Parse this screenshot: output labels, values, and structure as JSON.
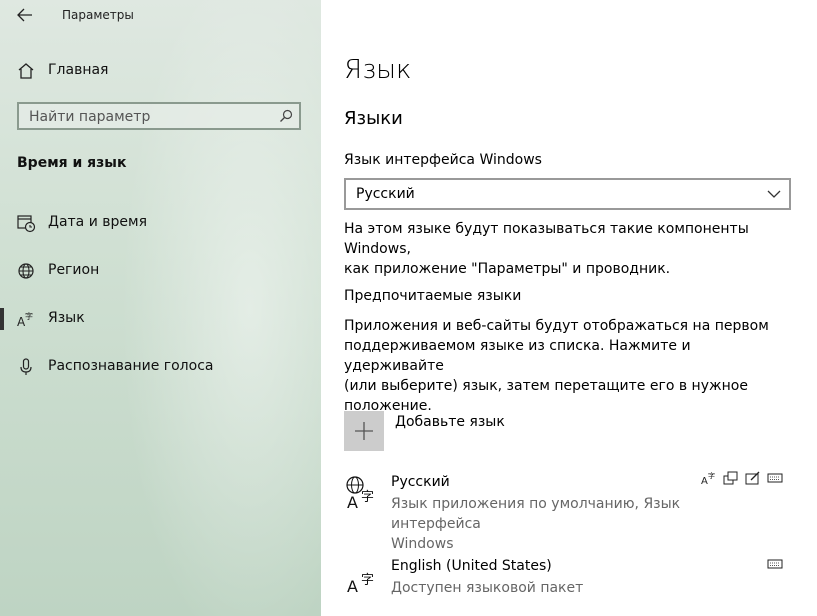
{
  "window": {
    "title": "Параметры"
  },
  "sidebar": {
    "home_label": "Главная",
    "search_placeholder": "Найти параметр",
    "section_title": "Время и язык",
    "items": [
      {
        "label": "Дата и время",
        "icon": "calendar-clock-icon"
      },
      {
        "label": "Регион",
        "icon": "globe-icon"
      },
      {
        "label": "Язык",
        "icon": "language-icon",
        "active": true
      },
      {
        "label": "Распознавание голоса",
        "icon": "microphone-icon"
      }
    ]
  },
  "main": {
    "page_title": "Язык",
    "section_title": "Языки",
    "display_language": {
      "label": "Язык интерфейса Windows",
      "selected": "Русский",
      "description_line1": "На этом языке будут показываться такие компоненты Windows,",
      "description_line2": "как приложение \"Параметры\" и проводник."
    },
    "preferred": {
      "title": "Предпочитаемые языки",
      "description_line1": "Приложения и веб-сайты будут отображаться на первом",
      "description_line2": "поддерживаемом языке из списка. Нажмите и удерживайте",
      "description_line3": "(или выберите) язык, затем перетащите его в нужное",
      "description_line4": "положение.",
      "add_label": "Добавьте язык",
      "languages": [
        {
          "name": "Русский",
          "sub_line1": "Язык приложения по умолчанию, Язык интерфейса",
          "sub_line2": "Windows"
        },
        {
          "name": "English (United States)",
          "sub_line1": "Доступен языковой пакет"
        }
      ]
    }
  }
}
